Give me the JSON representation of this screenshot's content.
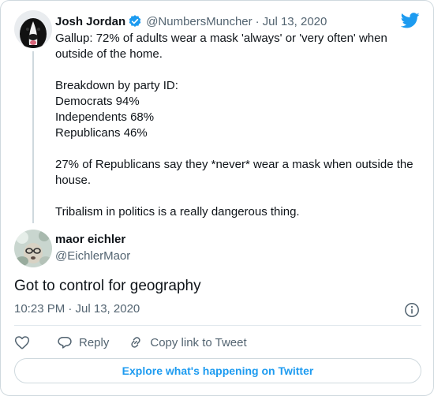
{
  "theme": {
    "accent": "#1d9bf0",
    "text": "#0f1419",
    "muted": "#536471",
    "border": "#cfd9de"
  },
  "parent_tweet": {
    "author_name": "Josh Jordan",
    "verified": true,
    "handle": "@NumbersMuncher",
    "separator": "·",
    "date": "Jul 13, 2020",
    "lines": [
      "Gallup: 72% of adults wear a mask 'always' or 'very often' when outside of the home.",
      "",
      "Breakdown by party ID:",
      "Democrats 94%",
      "Independents 68%",
      "Republicans 46%",
      "",
      "27% of Republicans say they *never* wear a mask when outside the house.",
      "",
      "Tribalism in politics is a really dangerous thing."
    ]
  },
  "reply_tweet": {
    "author_name": "maor eichler",
    "handle": "@EichlerMaor",
    "text": "Got to control for geography",
    "timestamp": "10:23 PM · Jul 13, 2020"
  },
  "actions": {
    "like_icon": "heart-icon",
    "reply_label": "Reply",
    "copy_link_label": "Copy link to Tweet"
  },
  "explore_label": "Explore what's happening on Twitter"
}
